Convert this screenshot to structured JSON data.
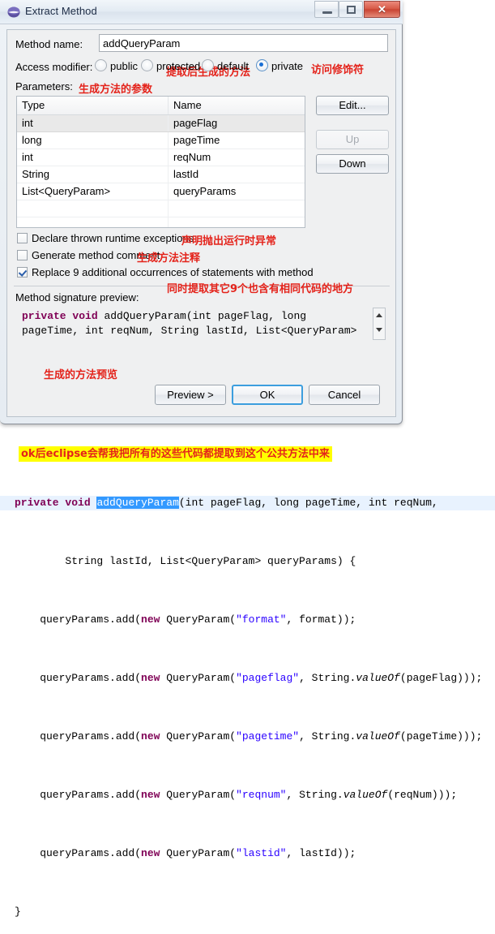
{
  "window": {
    "title": "Extract Method",
    "icon": "eclipse-icon",
    "buttons": {
      "minimize": "minimize-icon",
      "maximize": "maximize-icon",
      "close": "✕"
    }
  },
  "form": {
    "method_name_label": "Method name:",
    "method_name_value": "addQueryParam",
    "access_modifier_label": "Access modifier:",
    "access_options": [
      {
        "label": "public",
        "checked": false
      },
      {
        "label": "protected",
        "checked": false
      },
      {
        "label": "default",
        "checked": false
      },
      {
        "label": "private",
        "checked": true
      }
    ],
    "parameters_label": "Parameters:"
  },
  "parameters_table": {
    "headers": [
      "Type",
      "Name"
    ],
    "rows": [
      {
        "type": "int",
        "name": "pageFlag",
        "selected": true
      },
      {
        "type": "long",
        "name": "pageTime",
        "selected": false
      },
      {
        "type": "int",
        "name": "reqNum",
        "selected": false
      },
      {
        "type": "String",
        "name": "lastId",
        "selected": false
      },
      {
        "type": "List<QueryParam>",
        "name": "queryParams",
        "selected": false
      },
      {
        "type": "",
        "name": "",
        "selected": false
      },
      {
        "type": "",
        "name": "",
        "selected": false
      }
    ]
  },
  "side_buttons": {
    "edit": "Edit...",
    "up": "Up",
    "down": "Down"
  },
  "checkboxes": [
    {
      "label": "Declare thrown runtime exceptions",
      "checked": false
    },
    {
      "label": "Generate method comment",
      "checked": false
    },
    {
      "label": "Replace 9 additional occurrences of statements with method",
      "checked": true
    }
  ],
  "signature_preview": {
    "label": "Method signature preview:",
    "keyword1": "private",
    "keyword2": "void",
    "rest": " addQueryParam(int pageFlag, long pageTime, int reqNum, String lastId, List<QueryParam>"
  },
  "bottom_buttons": {
    "preview": "Preview >",
    "ok": "OK",
    "cancel": "Cancel"
  },
  "annotations": {
    "method_name": "提取后生成的方法",
    "access_modifier": "访问修饰符",
    "parameters": "生成方法的参数",
    "checkbox1": "声明抛出运行时异常",
    "checkbox2": "生成方法注释",
    "checkbox3": "同时提取其它9个也含有相同代码的地方",
    "signature": "生成的方法预览",
    "yellow_banner": "ok后eclipse会帮我把所有的这些代码都提取到这个公共方法中来"
  },
  "code": {
    "line1_kw1": "private",
    "line1_kw2": "void",
    "line1_selected": "addQueryParam",
    "line1_rest": "(int pageFlag, long pageTime, int reqNum,",
    "line2": "        String lastId, List<QueryParam> queryParams) {",
    "line3_pre": "    queryParams.add(",
    "line3_new": "new",
    "line3_mid": " QueryParam(",
    "line3_str": "\"format\"",
    "line3_post": ", format));",
    "line4_str": "\"pageflag\"",
    "line4_post": ", String.",
    "line4_italic": "valueOf",
    "line4_end": "(pageFlag)));",
    "line5_str": "\"pagetime\"",
    "line5_end": "(pageTime)));",
    "line6_str": "\"reqnum\"",
    "line6_end": "(reqNum)));",
    "line7_str": "\"lastid\"",
    "line7_post": ", lastId));",
    "line8": "}"
  },
  "colors": {
    "annotation_red": "#e4231b",
    "highlight_yellow": "#ffff00",
    "keyword_purple": "#7f0055",
    "string_blue": "#2a00ff",
    "selection_blue": "#3399ff",
    "current_line": "#e8f2fe",
    "ok_focus_border": "#3c9ede"
  }
}
